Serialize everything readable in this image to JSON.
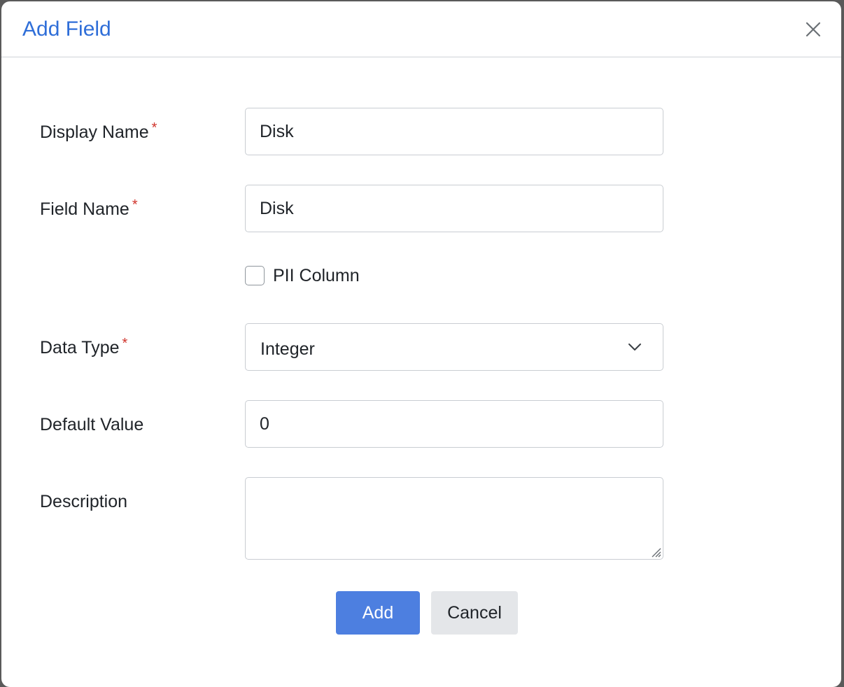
{
  "dialog": {
    "title": "Add Field"
  },
  "form": {
    "display_name": {
      "label": "Display Name",
      "required_mark": "*",
      "value": "Disk"
    },
    "field_name": {
      "label": "Field Name",
      "required_mark": "*",
      "value": "Disk"
    },
    "pii_column": {
      "label": "PII Column",
      "checked": false
    },
    "data_type": {
      "label": "Data Type",
      "required_mark": "*",
      "selected": "Integer"
    },
    "default_value": {
      "label": "Default Value",
      "value": "0"
    },
    "description": {
      "label": "Description",
      "value": ""
    }
  },
  "actions": {
    "add_label": "Add",
    "cancel_label": "Cancel"
  },
  "colors": {
    "title": "#2f6ed8",
    "required": "#d0342c",
    "primary_button": "#4d7fe0",
    "secondary_button": "#e4e6e9"
  },
  "icons": {
    "close": "close-icon",
    "select": "chevron-down-icon",
    "resize": "resize-grip-icon"
  }
}
